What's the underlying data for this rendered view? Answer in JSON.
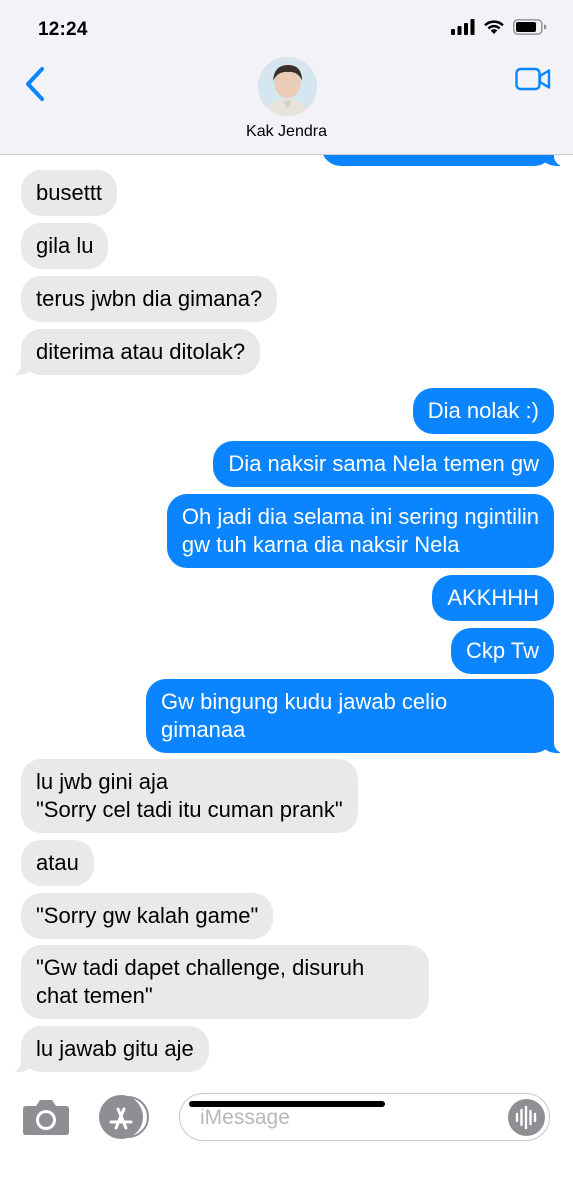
{
  "status_bar": {
    "time": "12:24",
    "icons": [
      "cellular-signal-icon",
      "wifi-icon",
      "battery-icon"
    ]
  },
  "header": {
    "contact_name": "Kak Jendra",
    "icons": [
      "back-chevron-icon",
      "avatar",
      "video-call-icon"
    ],
    "accent_color": "#0b84ff"
  },
  "messages": [
    {
      "from": "me",
      "text": ""
    },
    {
      "from": "them",
      "text": "busettt"
    },
    {
      "from": "them",
      "text": "gila lu"
    },
    {
      "from": "them",
      "text": "terus jwbn dia gimana?"
    },
    {
      "from": "them",
      "text": "diterima atau ditolak?"
    },
    {
      "from": "me",
      "text": "Dia nolak :)"
    },
    {
      "from": "me",
      "text": "Dia naksir sama Nela temen gw"
    },
    {
      "from": "me",
      "text": "Oh jadi dia selama ini sering ngintilin\ngw tuh karna dia naksir Nela"
    },
    {
      "from": "me",
      "text": "AKKHHH"
    },
    {
      "from": "me",
      "text": "Ckp Tw"
    },
    {
      "from": "me",
      "text": "Gw bingung kudu jawab celio\ngimanaa"
    },
    {
      "from": "them",
      "text": "lu jwb gini aja\n\"Sorry cel tadi itu cuman prank\""
    },
    {
      "from": "them",
      "text": "atau"
    },
    {
      "from": "them",
      "text": "\"Sorry gw kalah game\""
    },
    {
      "from": "them",
      "text": "\"Gw tadi dapet challenge, disuruh\nchat temen\""
    },
    {
      "from": "them",
      "text": "lu jawab gitu aje"
    }
  ],
  "colors": {
    "outgoing_bubble": "#0b84ff",
    "incoming_bubble": "#e9e9eb",
    "bar_background": "#f2f2f7"
  },
  "composer": {
    "placeholder": "iMessage",
    "icons": [
      "camera-icon",
      "app-store-icon",
      "audio-waveform-icon"
    ]
  }
}
